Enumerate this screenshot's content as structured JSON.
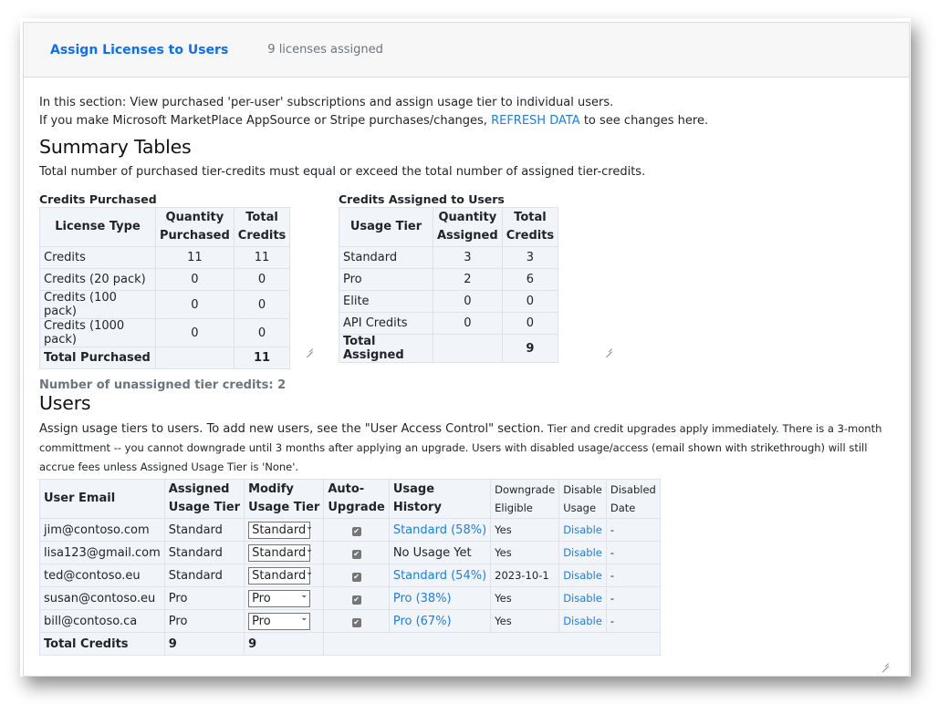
{
  "header": {
    "title": "Assign Licenses to Users",
    "subtitle": "9 licenses assigned"
  },
  "intro": {
    "line1": "In this section: View purchased 'per-user' subscriptions and assign usage tier to individual users.",
    "line2_prefix": "If you make Microsoft MarketPlace AppSource or Stripe purchases/changes, ",
    "refresh_link": "REFRESH DATA",
    "line2_suffix": " to see changes here."
  },
  "summary": {
    "heading": "Summary Tables",
    "note": "Total number of purchased tier-credits must equal or exceed the total number of assigned tier-credits.",
    "purchased": {
      "caption": "Credits Purchased",
      "headers": [
        "License Type",
        "Quantity Purchased",
        "Total Credits"
      ],
      "rows": [
        {
          "type": "Credits",
          "qty": "11",
          "total": "11"
        },
        {
          "type": "Credits (20 pack)",
          "qty": "0",
          "total": "0"
        },
        {
          "type": "Credits (100 pack)",
          "qty": "0",
          "total": "0"
        },
        {
          "type": "Credits (1000 pack)",
          "qty": "0",
          "total": "0"
        }
      ],
      "total_label": "Total Purchased",
      "total_value": "11"
    },
    "assigned": {
      "caption": "Credits Assigned to Users",
      "headers": [
        "Usage Tier",
        "Quantity Assigned",
        "Total Credits"
      ],
      "rows": [
        {
          "tier": "Standard",
          "qty": "3",
          "total": "3"
        },
        {
          "tier": "Pro",
          "qty": "2",
          "total": "6"
        },
        {
          "tier": "Elite",
          "qty": "0",
          "total": "0"
        },
        {
          "tier": "API Credits",
          "qty": "0",
          "total": "0"
        }
      ],
      "total_label": "Total Assigned",
      "total_value": "9"
    },
    "unassigned": "Number of unassigned tier credits: 2"
  },
  "users": {
    "heading": "Users",
    "note_main": "Assign usage tiers to users. To add new users, see the \"User Access Control\" section.",
    "note_small": " Tier and credit upgrades apply immediately. There is a 3-month committment -- you cannot downgrade until 3 months after applying an upgrade. Users with disabled usage/access (email shown with strikethrough) will still accrue fees unless Assigned Usage Tier is 'None'.",
    "headers": {
      "email": "User Email",
      "assigned_1": "Assigned",
      "assigned_2": "Usage Tier",
      "modify_1": "Modify",
      "modify_2": "Usage Tier",
      "auto_1": "Auto-",
      "auto_2": "Upgrade",
      "history_1": "Usage",
      "history_2": "History",
      "downgrade_1": "Downgrade",
      "downgrade_2": "Eligible",
      "disable_1": "Disable",
      "disable_2": "Usage",
      "disabled_1": "Disabled",
      "disabled_2": "Date"
    },
    "rows": [
      {
        "email": "jim@contoso.com",
        "assigned": "Standard",
        "modify": "Standard",
        "auto_upgrade": true,
        "history": "Standard (58%)",
        "history_link": true,
        "downgrade": "Yes",
        "disable": "Disable",
        "disabled_date": "-"
      },
      {
        "email": "lisa123@gmail.com",
        "assigned": "Standard",
        "modify": "Standard",
        "auto_upgrade": true,
        "history": "No Usage Yet",
        "history_link": false,
        "downgrade": "Yes",
        "disable": "Disable",
        "disabled_date": "-"
      },
      {
        "email": "ted@contoso.eu",
        "assigned": "Standard",
        "modify": "Standard",
        "auto_upgrade": true,
        "history": "Standard (54%)",
        "history_link": true,
        "downgrade": "2023-10-1",
        "disable": "Disable",
        "disabled_date": "-"
      },
      {
        "email": "susan@contoso.eu",
        "assigned": "Pro",
        "modify": "Pro",
        "auto_upgrade": true,
        "history": "Pro (38%)",
        "history_link": true,
        "downgrade": "Yes",
        "disable": "Disable",
        "disabled_date": "-"
      },
      {
        "email": "bill@contoso.ca",
        "assigned": "Pro",
        "modify": "Pro",
        "auto_upgrade": true,
        "history": "Pro (67%)",
        "history_link": true,
        "downgrade": "Yes",
        "disable": "Disable",
        "disabled_date": "-"
      }
    ],
    "total_label": "Total Credits",
    "total_assigned": "9",
    "total_modify": "9"
  },
  "icons": {
    "checkbox": "✔",
    "chevron": "❯"
  },
  "colors": {
    "accent": "#0d6efd",
    "link": "#1e7ee8",
    "table_bg": "#f1f4f8",
    "header_bg": "#f7f7f7"
  }
}
